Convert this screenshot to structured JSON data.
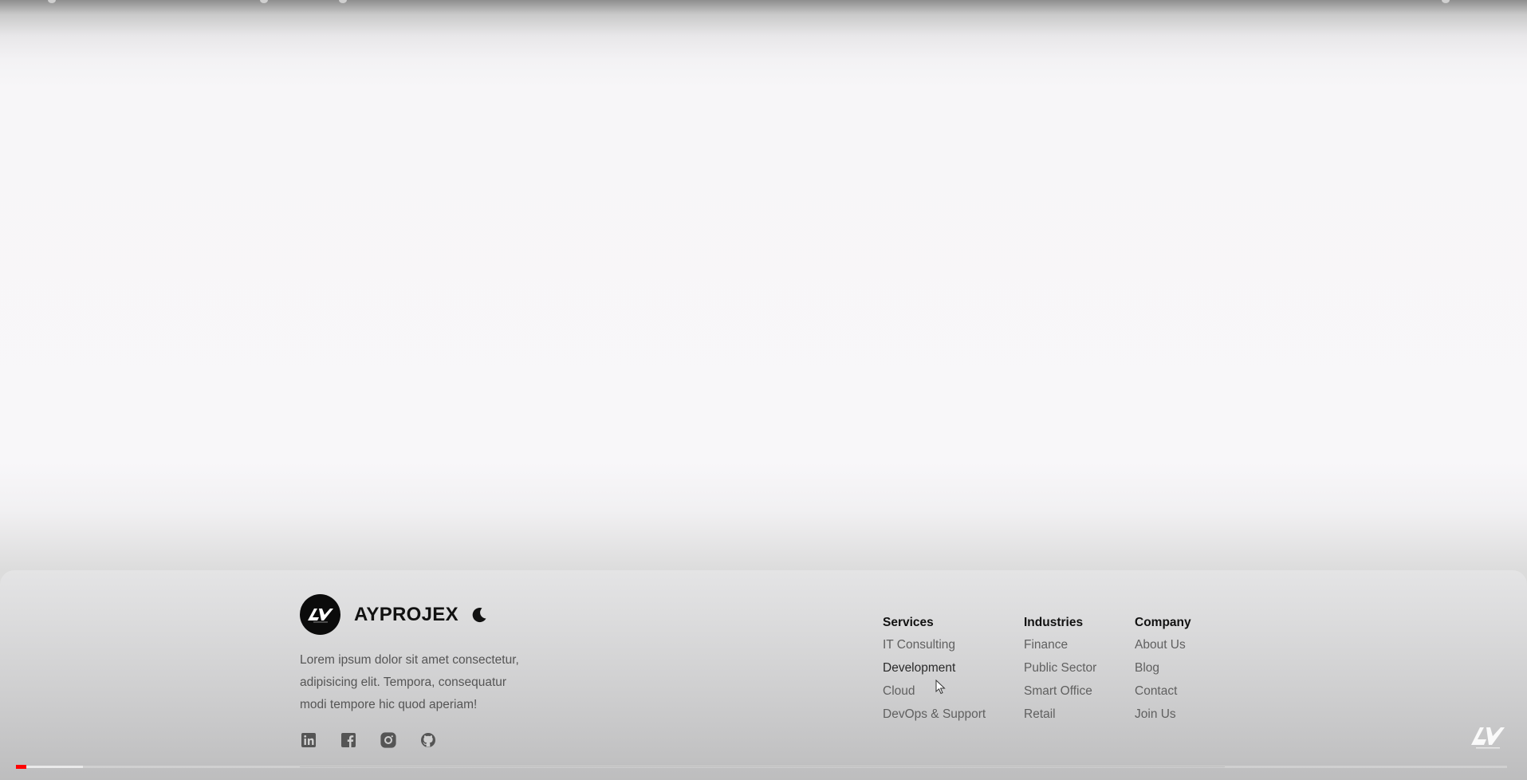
{
  "brand": {
    "name": "AYPROJEX",
    "logo_text": "AY",
    "theme_icon": "moon-icon",
    "description_lines": [
      "Lorem ipsum dolor sit amet consectetur,",
      "adipisicing elit. Tempora, consequatur",
      "modi tempore hic quod aperiam!"
    ]
  },
  "socials": [
    {
      "icon": "linkedin-icon"
    },
    {
      "icon": "facebook-icon"
    },
    {
      "icon": "instagram-icon"
    },
    {
      "icon": "github-icon"
    }
  ],
  "columns": [
    {
      "title": "Services",
      "links": [
        "IT Consulting",
        "Development",
        "Cloud",
        "DevOps & Support"
      ]
    },
    {
      "title": "Industries",
      "links": [
        "Finance",
        "Public Sector",
        "Smart Office",
        "Retail"
      ]
    },
    {
      "title": "Company",
      "links": [
        "About Us",
        "Blog",
        "Contact",
        "Join Us"
      ]
    }
  ],
  "video": {
    "played_fraction": 0.007,
    "loaded_fraction": 0.045,
    "watermark_icon": "ay-watermark-icon",
    "played_color": "#ff0000"
  },
  "colors": {
    "brand_text": "#111111",
    "link_text": "#606060",
    "logo_bg": "#0b0b0b"
  }
}
